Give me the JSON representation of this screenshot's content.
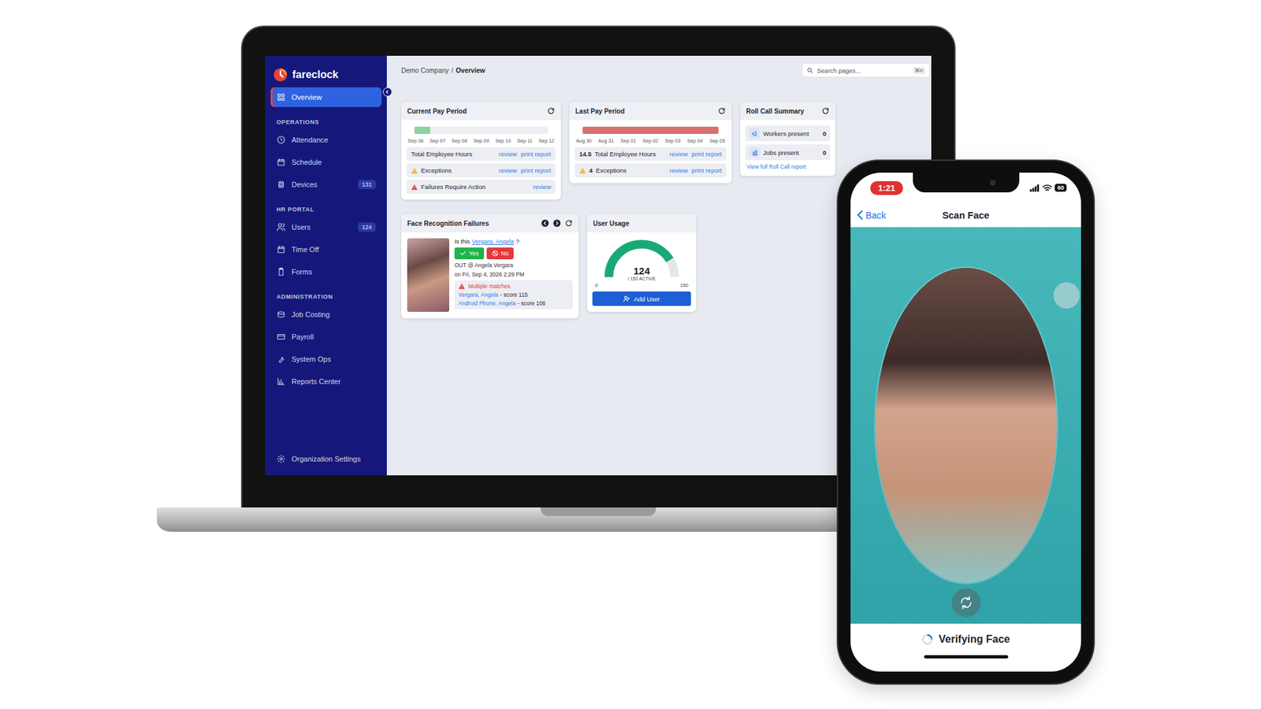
{
  "laptop": {
    "brand": "fareclock",
    "sidebar": {
      "top_item": {
        "label": "Overview",
        "selected": true
      },
      "sections": [
        {
          "title": "OPERATIONS",
          "items": [
            {
              "label": "Attendance",
              "selected": false
            },
            {
              "label": "Schedule",
              "selected": false
            },
            {
              "label": "Devices",
              "selected": false,
              "badge": "131"
            }
          ]
        },
        {
          "title": "HR PORTAL",
          "items": [
            {
              "label": "Users",
              "selected": false,
              "badge": "124"
            },
            {
              "label": "Time Off",
              "selected": false
            },
            {
              "label": "Forms",
              "selected": false
            }
          ]
        },
        {
          "title": "ADMINISTRATION",
          "items": [
            {
              "label": "Job Costing",
              "selected": false
            },
            {
              "label": "Payroll",
              "selected": false
            },
            {
              "label": "System Ops",
              "selected": false
            },
            {
              "label": "Reports Center",
              "selected": false
            }
          ]
        }
      ],
      "footer_item": {
        "label": "Organization Settings",
        "selected": false
      }
    },
    "breadcrumb": {
      "items": [
        "Demo Company",
        "Overview"
      ],
      "separator": "/"
    },
    "search": {
      "placeholder": "Search pages...",
      "shortcut": "⌘K"
    },
    "pay_periods": [
      {
        "title": "Current Pay Period",
        "level": 0.12,
        "color": "#8fd19e",
        "dates": [
          "Sep 06",
          "Sep 07",
          "Sep 08",
          "Sep 09",
          "Sep 10",
          "Sep 11",
          "Sep 12"
        ],
        "rows": [
          {
            "kind": "plain",
            "label": "Total Employee Hours",
            "links": [
              "review",
              "print report"
            ]
          },
          {
            "kind": "warning",
            "label": "Exceptions",
            "links": [
              "review",
              "print report"
            ]
          },
          {
            "kind": "error",
            "label": "Failures Require Action",
            "links": [
              "review"
            ]
          }
        ]
      },
      {
        "title": "Last Pay Period",
        "level": 1,
        "color": "#d9706f",
        "dates": [
          "Aug 30",
          "Aug 31",
          "Sep 01",
          "Sep 02",
          "Sep 03",
          "Sep 04",
          "Sep 05"
        ],
        "rows": [
          {
            "kind": "plain",
            "value": "14.5",
            "label": "Total Employee Hours",
            "links": [
              "review",
              "print report"
            ]
          },
          {
            "kind": "warning",
            "value": "4",
            "label": "Exceptions",
            "links": [
              "review",
              "print report"
            ]
          }
        ]
      }
    ],
    "roll_call": {
      "title": "Roll Call Summary",
      "rows": [
        {
          "label": "Workers present",
          "value": "0"
        },
        {
          "label": "Jobs present",
          "value": "0"
        }
      ],
      "link": "View full Roll Call report"
    },
    "face_failures": {
      "title": "Face Recognition Failures",
      "question": {
        "prefix": "Is this",
        "name": "Vergara, Angela",
        "suffix": "?"
      },
      "yes": "Yes",
      "no": "No",
      "event": "OUT @ Angela Vergara",
      "time": "on Fri, Sep 4, 2026 2:29 PM",
      "warning": "Multiple matches",
      "matches": [
        {
          "name": "Vergara, Angela",
          "score": "- score 115"
        },
        {
          "name": "Android Phone, Angela",
          "score": "- score 106"
        }
      ]
    },
    "user_usage": {
      "title": "User Usage",
      "value": "124",
      "caption": "/ 150 ACTIVE",
      "level": 0.827,
      "min": "0",
      "max": "150",
      "button": "Add User"
    }
  },
  "phone": {
    "status": {
      "time": "1:21",
      "battery": "60"
    },
    "back": "Back",
    "title": "Scan Face",
    "status_text": "Verifying Face"
  }
}
